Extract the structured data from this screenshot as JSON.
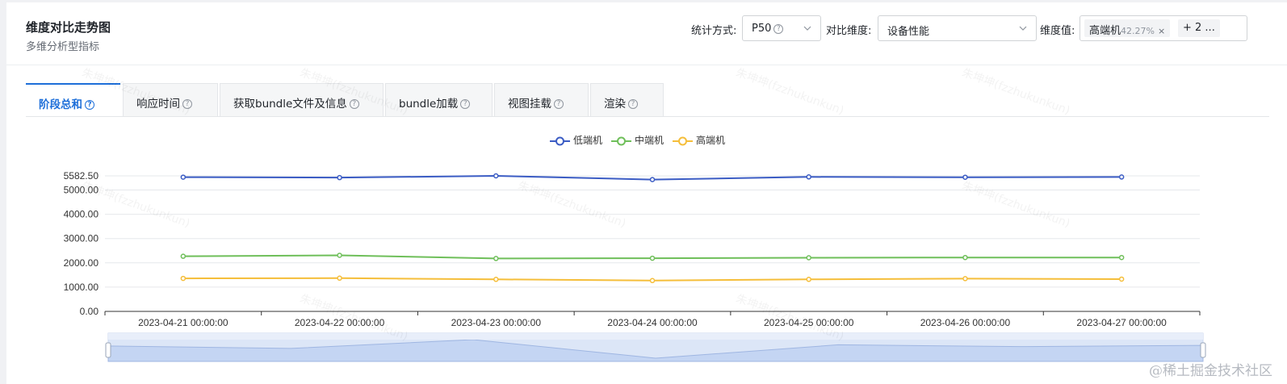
{
  "header": {
    "title": "维度对比走势图",
    "subtitle": "多维分析型指标"
  },
  "controls": {
    "stat_label": "统计方式:",
    "stat_value": "P50",
    "compare_label": "对比维度:",
    "compare_value": "设备性能",
    "dim_label": "维度值:",
    "dim_tag_name": "高端机",
    "dim_tag_pct": "42.27%",
    "dim_tag_close": "×",
    "dim_more": "+ 2 ..."
  },
  "tabs": [
    {
      "label": "阶段总和",
      "active": true
    },
    {
      "label": "响应时间",
      "active": false
    },
    {
      "label": "获取bundle文件及信息",
      "active": false
    },
    {
      "label": "bundle加载",
      "active": false
    },
    {
      "label": "视图挂载",
      "active": false
    },
    {
      "label": "渲染",
      "active": false
    }
  ],
  "icons": {
    "help": "question-circle-icon",
    "dropdown": "chevron-down-icon"
  },
  "colors": {
    "accent": "#1e6fd9",
    "low": "#3b5cc4",
    "mid": "#6fbf5a",
    "high": "#f5be3a"
  },
  "chart_data": {
    "type": "line",
    "x": [
      "2023-04-21 00:00:00",
      "2023-04-22 00:00:00",
      "2023-04-23 00:00:00",
      "2023-04-24 00:00:00",
      "2023-04-25 00:00:00",
      "2023-04-26 00:00:00",
      "2023-04-27 00:00:00"
    ],
    "series": [
      {
        "name": "低端机",
        "values": [
          5530,
          5510,
          5582.5,
          5430,
          5540,
          5525,
          5535
        ]
      },
      {
        "name": "中端机",
        "values": [
          2270,
          2310,
          2180,
          2190,
          2210,
          2220,
          2220
        ]
      },
      {
        "name": "高端机",
        "values": [
          1360,
          1370,
          1320,
          1270,
          1320,
          1350,
          1330
        ]
      }
    ],
    "y_ticks": [
      "0.00",
      "1000.00",
      "2000.00",
      "3000.00",
      "4000.00",
      "5000.00",
      "5582.50"
    ],
    "ylim": [
      0,
      5582.5
    ],
    "grid": true,
    "legend_position": "top-center",
    "datazoom": true
  },
  "watermark": "朱坤坤(fzzhukunkun)",
  "site_mark": "@稀土掘金技术社区"
}
